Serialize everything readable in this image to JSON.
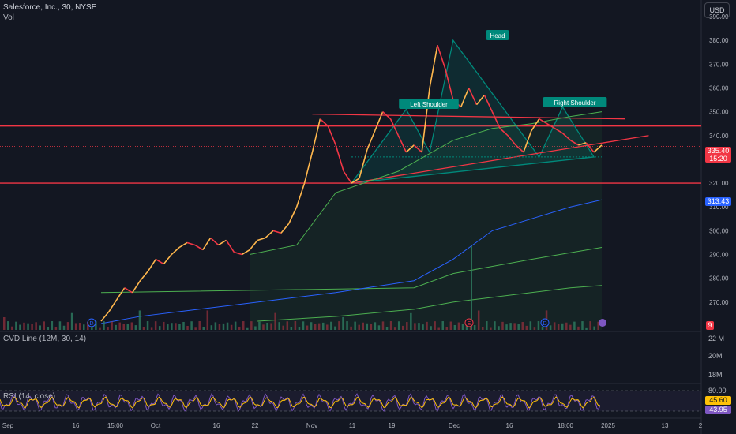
{
  "header": {
    "title": "Salesforce, Inc., 30, NYSE",
    "volume_label": "Vol"
  },
  "currency_button": "USD",
  "last_price_tag": {
    "price": "335.40",
    "countdown": "15:20",
    "color": "#f23645"
  },
  "blue_line_tag": {
    "value": "313.43",
    "color": "#2962ff"
  },
  "volume_tag": {
    "value": "9",
    "color": "#f23645"
  },
  "colors": {
    "background": "#131722",
    "up": "#ffb74d",
    "down": "#f23645",
    "pattern_fill": "#00897b",
    "red_line": "#f23645",
    "blue_line": "#2962ff",
    "green_line": "#4caf50",
    "rsi_line": "#7e57c2",
    "cvd_line": "#ffc107"
  },
  "pattern_labels": {
    "left_shoulder": "Left Shoulder",
    "head": "Head",
    "right_shoulder": "Right Shoulder"
  },
  "indicators": {
    "cvd": {
      "title": "CVD Line (12M, 30, 14)",
      "axis": [
        "22 M",
        "20M",
        "18M"
      ]
    },
    "rsi": {
      "title": "RSI (14, close)",
      "axis": [
        "80.00"
      ],
      "value1": "45.60",
      "value2": "43.95"
    }
  },
  "event_markers": [
    "D",
    "E",
    "D"
  ],
  "chart_data": {
    "type": "line",
    "title": "Salesforce, Inc., 30, NYSE",
    "price_axis": [
      "390.00",
      "380.00",
      "370.00",
      "360.00",
      "350.00",
      "340.00",
      "320.00",
      "310.00",
      "300.00",
      "290.00",
      "280.00",
      "270.00"
    ],
    "ylim": [
      260,
      392
    ],
    "x_ticks": [
      "Sep",
      "16",
      "15:00",
      "Oct",
      "16",
      "22",
      "Nov",
      "11",
      "19",
      "Dec",
      "16",
      "18:00",
      "2025",
      "13",
      "2"
    ],
    "price_path": {
      "x": [
        0,
        1,
        2,
        3,
        4,
        5,
        6,
        7,
        8,
        9,
        10,
        11,
        12,
        13,
        14,
        15,
        16,
        17,
        18,
        19,
        20,
        21,
        22,
        23,
        24,
        25,
        26,
        27,
        28,
        29,
        30,
        31,
        32,
        33,
        34,
        35,
        36,
        37,
        38,
        39,
        40,
        41,
        42,
        43,
        44,
        45,
        46,
        47,
        48,
        49,
        50,
        51,
        52,
        53,
        54,
        55,
        56,
        57,
        58,
        59,
        60,
        61,
        62,
        63,
        64
      ],
      "y": [
        262,
        266,
        271,
        276,
        274,
        279,
        283,
        288,
        286,
        290,
        293,
        295,
        294,
        292,
        297,
        294,
        296,
        291,
        290,
        292,
        296,
        297,
        300,
        299,
        303,
        310,
        320,
        333,
        347,
        344,
        336,
        325,
        320,
        322,
        334,
        342,
        350,
        347,
        340,
        333,
        336,
        333,
        360,
        378,
        368,
        355,
        352,
        360,
        353,
        357,
        350,
        343,
        340,
        336,
        333,
        342,
        347,
        345,
        343,
        341,
        338,
        336,
        337,
        333,
        336
      ]
    },
    "resistance_levels": [
      344,
      320
    ],
    "blue_line": {
      "x": [
        0,
        5,
        10,
        20,
        30,
        40,
        45,
        50,
        55,
        60,
        64
      ],
      "y": [
        261,
        264,
        266,
        270,
        274,
        279,
        288,
        300,
        305,
        310,
        313
      ]
    },
    "green_line_upper": {
      "x": [
        19,
        25,
        30,
        38,
        45,
        50,
        55,
        60,
        64
      ],
      "y": [
        290,
        294,
        316,
        325,
        338,
        343,
        345,
        348,
        350
      ]
    },
    "green_line_long": {
      "x": [
        0,
        20,
        40,
        45,
        55,
        64
      ],
      "y": [
        274,
        275,
        276,
        282,
        288,
        293
      ]
    },
    "green_line_low": {
      "x": [
        20,
        30,
        40,
        45,
        50,
        55,
        60,
        64
      ],
      "y": [
        262,
        264,
        267,
        270,
        272,
        274,
        276,
        277
      ]
    },
    "head_and_shoulders": {
      "points": [
        {
          "x": 32,
          "y": 320
        },
        {
          "x": 39,
          "y": 351
        },
        {
          "x": 42,
          "y": 333
        },
        {
          "x": 45,
          "y": 380
        },
        {
          "x": 56,
          "y": 331
        },
        {
          "x": 59,
          "y": 352
        },
        {
          "x": 63,
          "y": 331
        }
      ]
    }
  }
}
